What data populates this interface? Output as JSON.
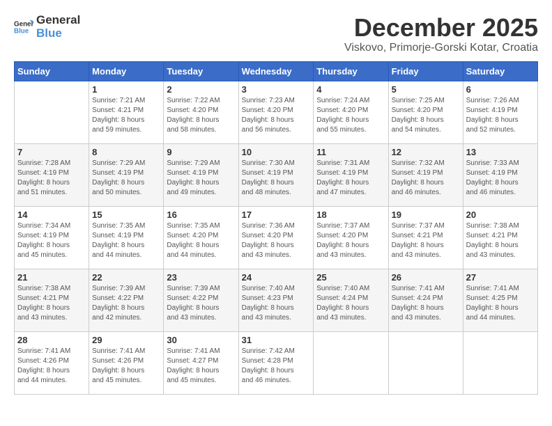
{
  "logo": {
    "text_general": "General",
    "text_blue": "Blue"
  },
  "title": "December 2025",
  "subtitle": "Viskovo, Primorje-Gorski Kotar, Croatia",
  "days_of_week": [
    "Sunday",
    "Monday",
    "Tuesday",
    "Wednesday",
    "Thursday",
    "Friday",
    "Saturday"
  ],
  "weeks": [
    [
      {
        "day": "",
        "info": ""
      },
      {
        "day": "1",
        "info": "Sunrise: 7:21 AM\nSunset: 4:21 PM\nDaylight: 8 hours\nand 59 minutes."
      },
      {
        "day": "2",
        "info": "Sunrise: 7:22 AM\nSunset: 4:20 PM\nDaylight: 8 hours\nand 58 minutes."
      },
      {
        "day": "3",
        "info": "Sunrise: 7:23 AM\nSunset: 4:20 PM\nDaylight: 8 hours\nand 56 minutes."
      },
      {
        "day": "4",
        "info": "Sunrise: 7:24 AM\nSunset: 4:20 PM\nDaylight: 8 hours\nand 55 minutes."
      },
      {
        "day": "5",
        "info": "Sunrise: 7:25 AM\nSunset: 4:20 PM\nDaylight: 8 hours\nand 54 minutes."
      },
      {
        "day": "6",
        "info": "Sunrise: 7:26 AM\nSunset: 4:19 PM\nDaylight: 8 hours\nand 52 minutes."
      }
    ],
    [
      {
        "day": "7",
        "info": "Sunrise: 7:28 AM\nSunset: 4:19 PM\nDaylight: 8 hours\nand 51 minutes."
      },
      {
        "day": "8",
        "info": "Sunrise: 7:29 AM\nSunset: 4:19 PM\nDaylight: 8 hours\nand 50 minutes."
      },
      {
        "day": "9",
        "info": "Sunrise: 7:29 AM\nSunset: 4:19 PM\nDaylight: 8 hours\nand 49 minutes."
      },
      {
        "day": "10",
        "info": "Sunrise: 7:30 AM\nSunset: 4:19 PM\nDaylight: 8 hours\nand 48 minutes."
      },
      {
        "day": "11",
        "info": "Sunrise: 7:31 AM\nSunset: 4:19 PM\nDaylight: 8 hours\nand 47 minutes."
      },
      {
        "day": "12",
        "info": "Sunrise: 7:32 AM\nSunset: 4:19 PM\nDaylight: 8 hours\nand 46 minutes."
      },
      {
        "day": "13",
        "info": "Sunrise: 7:33 AM\nSunset: 4:19 PM\nDaylight: 8 hours\nand 46 minutes."
      }
    ],
    [
      {
        "day": "14",
        "info": "Sunrise: 7:34 AM\nSunset: 4:19 PM\nDaylight: 8 hours\nand 45 minutes."
      },
      {
        "day": "15",
        "info": "Sunrise: 7:35 AM\nSunset: 4:19 PM\nDaylight: 8 hours\nand 44 minutes."
      },
      {
        "day": "16",
        "info": "Sunrise: 7:35 AM\nSunset: 4:20 PM\nDaylight: 8 hours\nand 44 minutes."
      },
      {
        "day": "17",
        "info": "Sunrise: 7:36 AM\nSunset: 4:20 PM\nDaylight: 8 hours\nand 43 minutes."
      },
      {
        "day": "18",
        "info": "Sunrise: 7:37 AM\nSunset: 4:20 PM\nDaylight: 8 hours\nand 43 minutes."
      },
      {
        "day": "19",
        "info": "Sunrise: 7:37 AM\nSunset: 4:21 PM\nDaylight: 8 hours\nand 43 minutes."
      },
      {
        "day": "20",
        "info": "Sunrise: 7:38 AM\nSunset: 4:21 PM\nDaylight: 8 hours\nand 43 minutes."
      }
    ],
    [
      {
        "day": "21",
        "info": "Sunrise: 7:38 AM\nSunset: 4:21 PM\nDaylight: 8 hours\nand 43 minutes."
      },
      {
        "day": "22",
        "info": "Sunrise: 7:39 AM\nSunset: 4:22 PM\nDaylight: 8 hours\nand 42 minutes."
      },
      {
        "day": "23",
        "info": "Sunrise: 7:39 AM\nSunset: 4:22 PM\nDaylight: 8 hours\nand 43 minutes."
      },
      {
        "day": "24",
        "info": "Sunrise: 7:40 AM\nSunset: 4:23 PM\nDaylight: 8 hours\nand 43 minutes."
      },
      {
        "day": "25",
        "info": "Sunrise: 7:40 AM\nSunset: 4:24 PM\nDaylight: 8 hours\nand 43 minutes."
      },
      {
        "day": "26",
        "info": "Sunrise: 7:41 AM\nSunset: 4:24 PM\nDaylight: 8 hours\nand 43 minutes."
      },
      {
        "day": "27",
        "info": "Sunrise: 7:41 AM\nSunset: 4:25 PM\nDaylight: 8 hours\nand 44 minutes."
      }
    ],
    [
      {
        "day": "28",
        "info": "Sunrise: 7:41 AM\nSunset: 4:26 PM\nDaylight: 8 hours\nand 44 minutes."
      },
      {
        "day": "29",
        "info": "Sunrise: 7:41 AM\nSunset: 4:26 PM\nDaylight: 8 hours\nand 45 minutes."
      },
      {
        "day": "30",
        "info": "Sunrise: 7:41 AM\nSunset: 4:27 PM\nDaylight: 8 hours\nand 45 minutes."
      },
      {
        "day": "31",
        "info": "Sunrise: 7:42 AM\nSunset: 4:28 PM\nDaylight: 8 hours\nand 46 minutes."
      },
      {
        "day": "",
        "info": ""
      },
      {
        "day": "",
        "info": ""
      },
      {
        "day": "",
        "info": ""
      }
    ]
  ]
}
